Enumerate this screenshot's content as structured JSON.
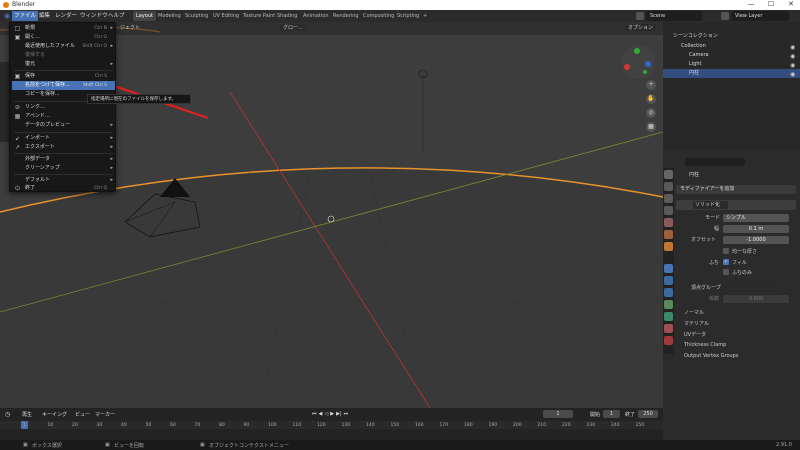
{
  "window": {
    "title": "Blender",
    "min": "—",
    "max": "☐",
    "close": "✕"
  },
  "menubar": {
    "items": [
      "ファイル",
      "編集",
      "レンダー",
      "ウィンドウ",
      "ヘルプ"
    ],
    "workspaces": [
      "Layout",
      "Modeling",
      "Sculpting",
      "UV Editing",
      "Texture Paint",
      "Shading",
      "Animation",
      "Rendering",
      "Compositing",
      "Scripting"
    ],
    "add_tab": "+",
    "scene": "Scene",
    "view_layer": "View Layer"
  },
  "viewport": {
    "options": "オプション",
    "header_label": "グロー...",
    "object_mode_suffix": "ジェクト"
  },
  "file_menu": {
    "items": [
      {
        "label": "新規",
        "shortcut": "Ctrl N",
        "arrow": "▸",
        "icon": "□"
      },
      {
        "label": "開く...",
        "shortcut": "Ctrl O",
        "icon": "▣"
      },
      {
        "label": "最近使用したファイル",
        "shortcut": "Shift Ctrl O",
        "arrow": "▸"
      },
      {
        "label": "復帰する"
      },
      {
        "label": "復元",
        "arrow": "▸"
      },
      {
        "label": "保存",
        "shortcut": "Ctrl S",
        "icon": "▣"
      },
      {
        "label": "名前をつけて保存...",
        "shortcut": "Shift Ctrl S"
      },
      {
        "label": "コピーを保存..."
      },
      {
        "label": "リンク...",
        "icon": "⊘"
      },
      {
        "label": "アペンド...",
        "icon": "▦"
      },
      {
        "label": "データのプレビュー",
        "arrow": "▸"
      },
      {
        "label": "インポート",
        "arrow": "▸",
        "icon": "↙"
      },
      {
        "label": "エクスポート",
        "arrow": "▸",
        "icon": "↗"
      },
      {
        "label": "外部データ",
        "arrow": "▸"
      },
      {
        "label": "クリーンアップ",
        "arrow": "▸"
      },
      {
        "label": "デフォルト",
        "arrow": "▸"
      },
      {
        "label": "終了",
        "shortcut": "Ctrl Q",
        "icon": "⏻"
      }
    ],
    "tooltip": "指定場所に現在のファイルを保存します。"
  },
  "outliner": {
    "header": "シーンコレクション",
    "rows": [
      "Collection",
      "Camera",
      "Light",
      "円柱"
    ]
  },
  "properties": {
    "object": "円柱",
    "add_modifier": "モディファイアーを追加",
    "modifier_name": "ソリッド化",
    "mode_label": "モード",
    "mode_value": "シンプル",
    "width_label": "幅",
    "width_value": "0.1 m",
    "offset_label": "オフセット",
    "offset_value": "-1.0000",
    "even_label": "均一な厚さ",
    "rim_label": "ふち",
    "rim_fill": "フィル",
    "rim_only": "ふちのみ",
    "vgroup_label": "頂点グループ",
    "factor_label": "係数",
    "factor_value": "0.000",
    "sections": [
      "ノーマル",
      "マテリアル",
      "UVデータ",
      "Thickness Clamp",
      "Output Vertex Groups"
    ]
  },
  "timeline": {
    "menu": [
      "再生",
      "キーイング",
      "ビュー",
      "マーカー"
    ],
    "current": "1",
    "start_label": "開始",
    "start": "1",
    "end_label": "終了",
    "end": "250",
    "ticks": [
      "1",
      "10",
      "20",
      "30",
      "40",
      "50",
      "60",
      "70",
      "80",
      "90",
      "100",
      "110",
      "120",
      "130",
      "140",
      "150",
      "160",
      "170",
      "180",
      "190",
      "200",
      "210",
      "220",
      "230",
      "240",
      "250"
    ]
  },
  "statusbar": {
    "items": [
      "ボックス選択",
      "ビューを回転",
      "オブジェクトコンテクストメニュー"
    ],
    "version": "2.91.0"
  }
}
